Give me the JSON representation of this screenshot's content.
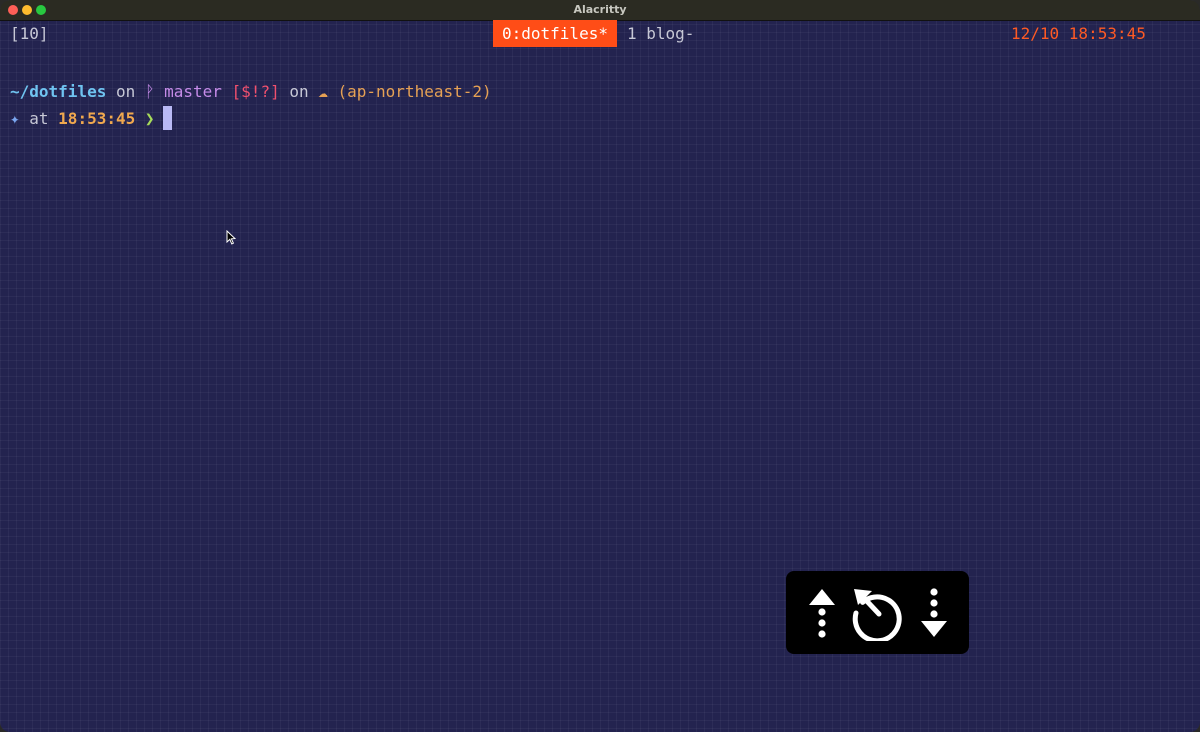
{
  "window": {
    "title": "Alacritty"
  },
  "tmux": {
    "session": "[10]",
    "active_window": "0:dotfiles*",
    "inactive_window": "1 blog-",
    "clock": "12/10 18:53:45"
  },
  "prompt": {
    "dir": "~/dotfiles",
    "on1": " on ",
    "branch_icon": "ᚹ",
    "branch": " master",
    "git_status": " [$!?]",
    "on2": " on ",
    "cloud_icon": "☁",
    "region": " (ap-northeast-2)",
    "star": "✦",
    "at": " at ",
    "time": "18:53:45",
    "arrow": " ❯"
  },
  "icons": {
    "scroll_up": "scroll-up-icon",
    "replay": "replay-icon",
    "scroll_down": "scroll-down-icon",
    "mouse": "mouse-pointer-icon"
  },
  "colors": {
    "background": "#23234f",
    "tmux_active": "#ff4d17",
    "clock": "#ff5a24",
    "dir": "#6fc3f0",
    "branch": "#c58be8",
    "git_status": "#f0506e",
    "region": "#e6a154",
    "time": "#f0a84e",
    "arrow": "#a7dc5a"
  }
}
